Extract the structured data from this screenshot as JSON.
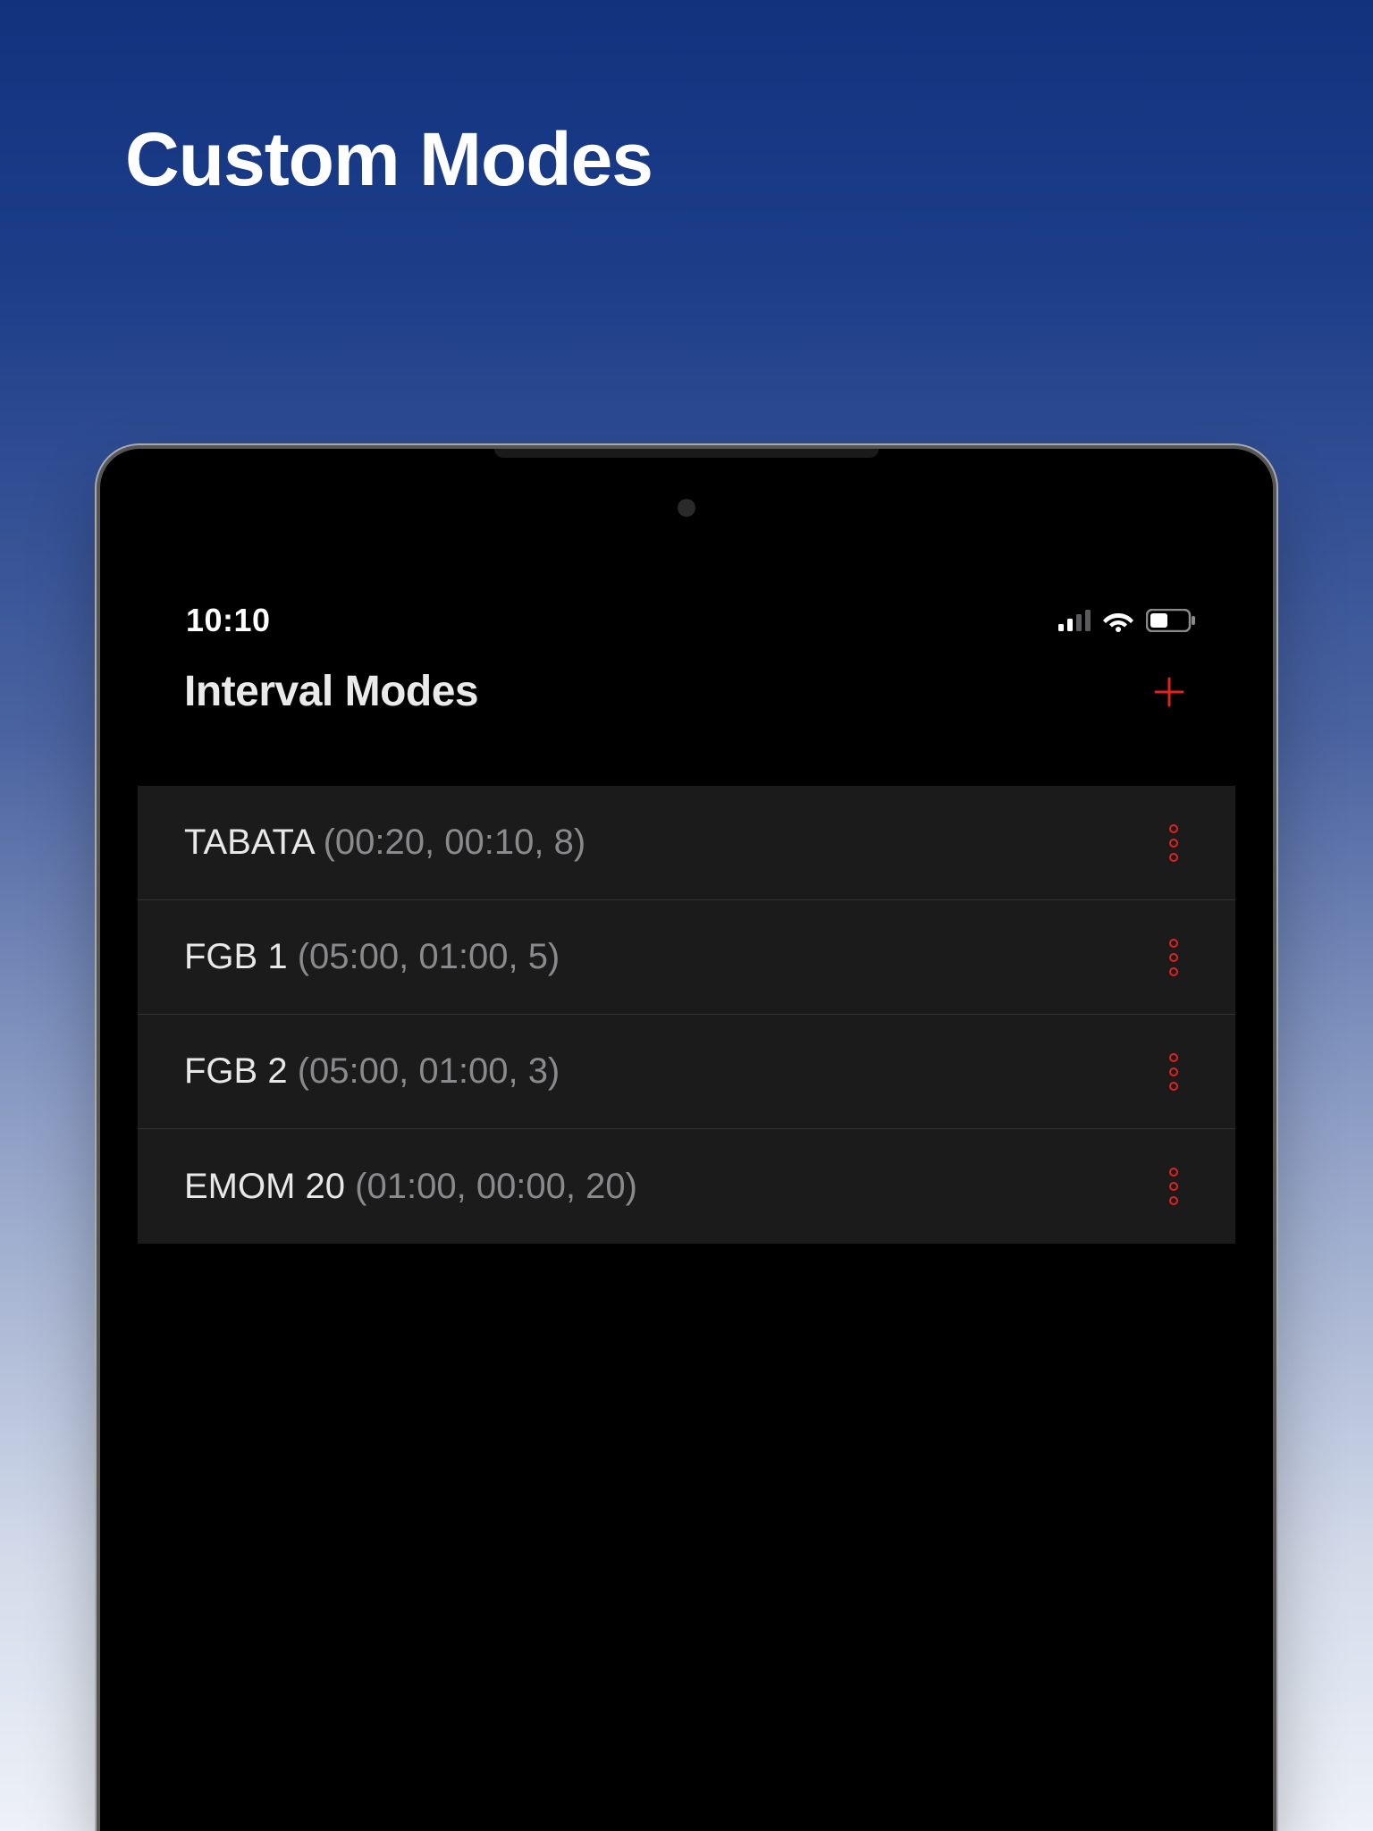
{
  "promo": {
    "title": "Custom Modes"
  },
  "status": {
    "time": "10:10"
  },
  "nav": {
    "title": "Interval Modes"
  },
  "accent": "#e02222",
  "modes": [
    {
      "name": "TABATA",
      "detail": "(00:20, 00:10, 8)"
    },
    {
      "name": "FGB 1",
      "detail": "(05:00, 01:00, 5)"
    },
    {
      "name": "FGB 2",
      "detail": "(05:00, 01:00, 3)"
    },
    {
      "name": "EMOM 20",
      "detail": "(01:00, 00:00, 20)"
    }
  ]
}
